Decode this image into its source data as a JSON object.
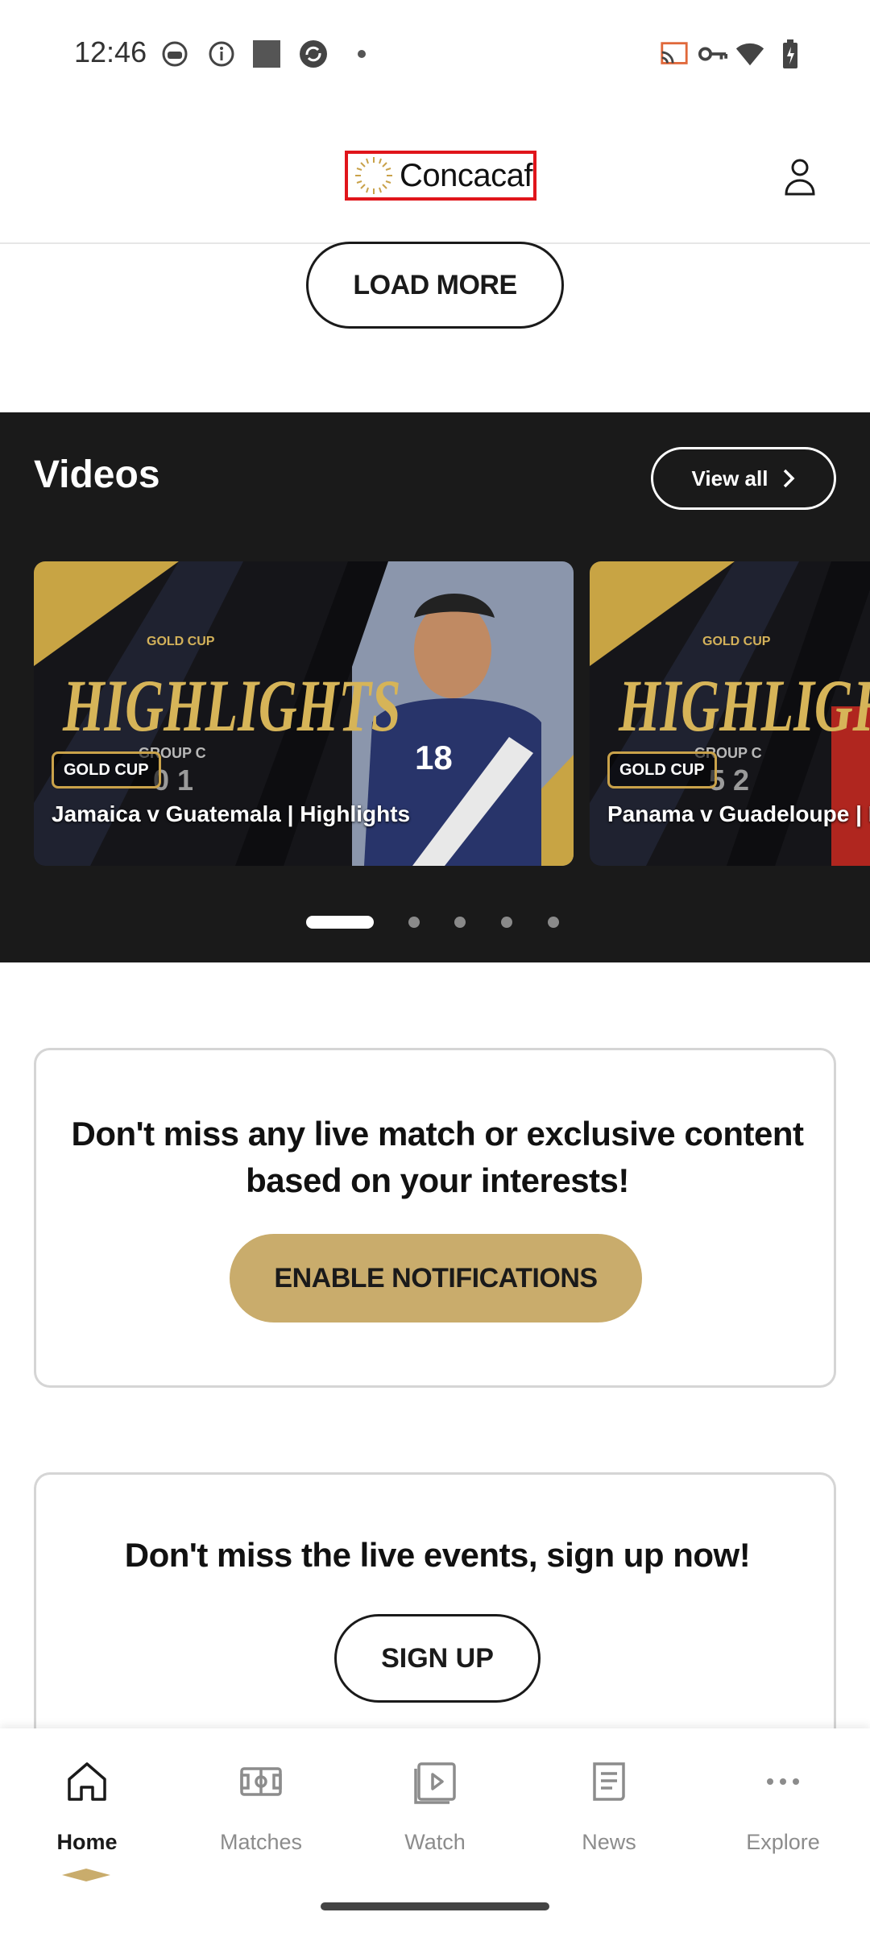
{
  "status_bar": {
    "time": "12:46",
    "left_icons": [
      "face-icon",
      "info-icon",
      "square-icon",
      "sync-icon",
      "dot-icon"
    ],
    "right_icons": [
      "cast-icon",
      "key-icon",
      "wifi-icon",
      "battery-icon"
    ]
  },
  "header": {
    "logo_text": "Concacaf",
    "profile_icon": "person-icon"
  },
  "load_more": {
    "label": "LOAD MORE"
  },
  "videos": {
    "title": "Videos",
    "view_all_label": "View all",
    "cards": [
      {
        "badge": "GOLD CUP",
        "title": "Jamaica v Guatemala | Highlights",
        "banner": "HIGHLIGHTS",
        "group": "GROUP C",
        "score": "0 1",
        "tournament": "GOLD CUP"
      },
      {
        "badge": "GOLD CUP",
        "title": "Panama v Guadeloupe | Highlights",
        "banner": "HIGHLIGHTS",
        "group": "GROUP C",
        "score": "5 2",
        "tournament": "GOLD CUP"
      }
    ],
    "pagination": {
      "total": 5,
      "active": 1
    }
  },
  "notifications_card": {
    "title": "Don't miss any live match or exclusive content based on your interests!",
    "button_label": "ENABLE NOTIFICATIONS"
  },
  "signup_card": {
    "title": "Don't miss the live events, sign up now!",
    "button_label": "SIGN UP"
  },
  "bottom_nav": {
    "items": [
      {
        "label": "Home",
        "icon": "home-icon",
        "active": true
      },
      {
        "label": "Matches",
        "icon": "pitch-icon",
        "active": false
      },
      {
        "label": "Watch",
        "icon": "play-icon",
        "active": false
      },
      {
        "label": "News",
        "icon": "news-icon",
        "active": false
      },
      {
        "label": "Explore",
        "icon": "more-icon",
        "active": false
      }
    ]
  },
  "colors": {
    "accent_gold": "#c9ac6c",
    "dark_section": "#1a1a1a",
    "highlight_border": "#e0151b"
  }
}
